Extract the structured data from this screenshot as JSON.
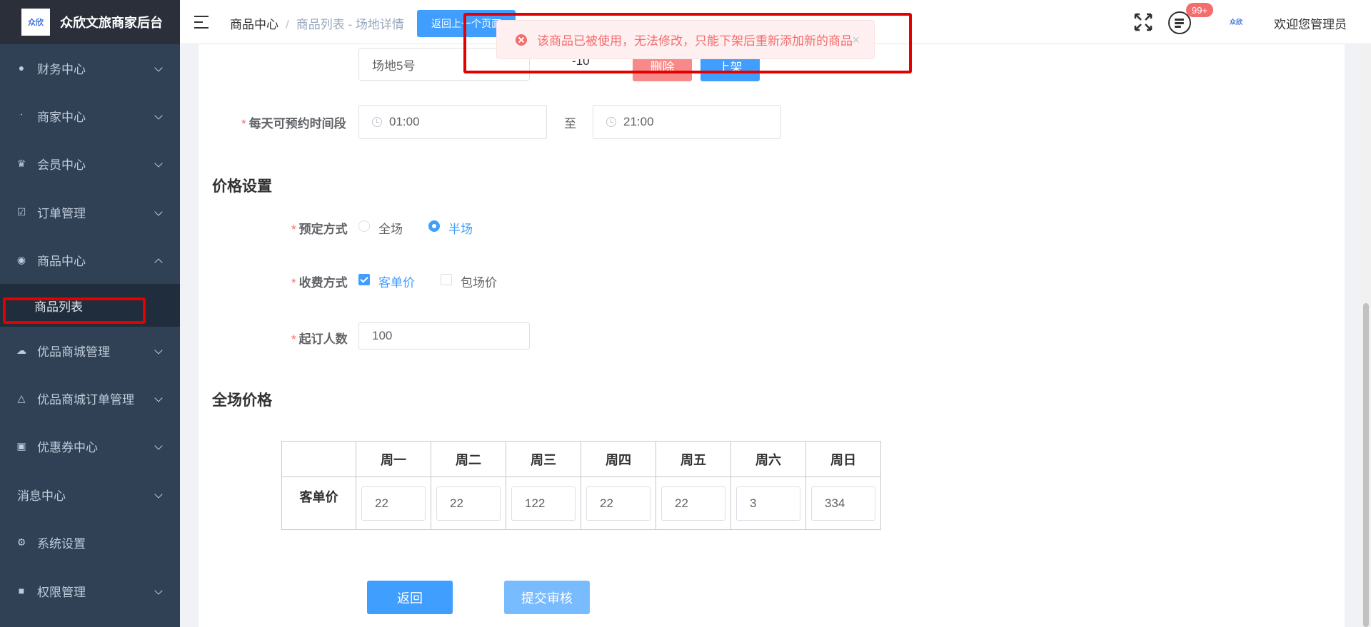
{
  "app": {
    "title": "众欣文旅商家后台",
    "logo_text": "众欣"
  },
  "sidebar": {
    "items": [
      {
        "label": "财务中心",
        "icon": "money-bag-icon"
      },
      {
        "label": "商家中心",
        "icon": "none"
      },
      {
        "label": "会员中心",
        "icon": "crown-icon"
      },
      {
        "label": "订单管理",
        "icon": "clipboard-icon"
      },
      {
        "label": "商品中心",
        "icon": "bag-icon"
      },
      {
        "label": "优品商城管理",
        "icon": "cloud-icon"
      },
      {
        "label": "优品商城订单管理",
        "icon": "cone-icon"
      },
      {
        "label": "优惠券中心",
        "icon": "ticket-icon"
      },
      {
        "label": "消息中心",
        "icon": "none"
      },
      {
        "label": "系统设置",
        "icon": "gear-icon"
      },
      {
        "label": "权限管理",
        "icon": "lock-icon"
      }
    ],
    "submenu_active": "商品列表"
  },
  "header": {
    "breadcrumb": [
      "商品中心",
      "商品列表 - 场地详情"
    ],
    "back_button": "返回上一个页面",
    "badge": "99+",
    "small_logo": "众欣",
    "welcome": "欢迎您管理员"
  },
  "toast": {
    "message": "该商品已被使用，无法修改，只能下架后重新添加新的商品",
    "close": "×"
  },
  "venue_row": {
    "name": "场地5号",
    "value": "-10",
    "delete_label": "删除",
    "shelf_label": "上架"
  },
  "time_slot": {
    "label": "每天可预约时间段",
    "start": "01:00",
    "to": "至",
    "end": "21:00"
  },
  "price_settings": {
    "title": "价格设置",
    "booking_label": "预定方式",
    "booking_options": [
      "全场",
      "半场"
    ],
    "booking_selected": "半场",
    "charge_label": "收费方式",
    "charge_options": [
      "客单价",
      "包场价"
    ],
    "charge_checked": [
      "客单价"
    ],
    "min_people_label": "起订人数",
    "min_people": "100"
  },
  "full_price": {
    "title": "全场价格",
    "days": [
      "周一",
      "周二",
      "周三",
      "周四",
      "周五",
      "周六",
      "周日"
    ],
    "row_label": "客单价",
    "values": [
      "22",
      "22",
      "122",
      "22",
      "22",
      "3",
      "334"
    ]
  },
  "actions": {
    "back": "返回",
    "submit": "提交审核"
  }
}
